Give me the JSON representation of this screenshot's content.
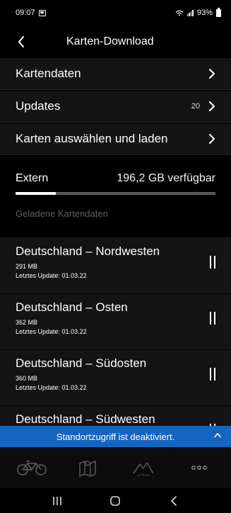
{
  "statusbar": {
    "time": "09:07",
    "battery": "93%"
  },
  "appbar": {
    "title": "Karten-Download"
  },
  "menu": [
    {
      "label": "Kartendaten",
      "count": ""
    },
    {
      "label": "Updates",
      "count": "20"
    },
    {
      "label": "Karten auswählen und laden",
      "count": ""
    }
  ],
  "storage": {
    "name": "Extern",
    "free": "196,2 GB verfügbar",
    "used_fraction": 0.2
  },
  "section_label": "Geladene Kartendaten",
  "maps": [
    {
      "name": "Deutschland – Nordwesten",
      "size": "291 MB",
      "update": "Letztes Update: 01.03.22"
    },
    {
      "name": "Deutschland – Osten",
      "size": "362 MB",
      "update": "Letztes Update: 01.03.22"
    },
    {
      "name": "Deutschland – Südosten",
      "size": "360 MB",
      "update": "Letztes Update: 01.03.22"
    },
    {
      "name": "Deutschland – Südwesten",
      "size": "",
      "update": ""
    }
  ],
  "banner": {
    "text": "Standortzugriff ist deaktiviert."
  },
  "bottom_nav": [
    {
      "icon": "bike-icon"
    },
    {
      "icon": "map-icon"
    },
    {
      "icon": "mountain-icon"
    },
    {
      "icon": "more-icon"
    }
  ],
  "colors": {
    "banner": "#1565c0",
    "row_bg": "#141414",
    "section_label": "#5f5f5f"
  }
}
